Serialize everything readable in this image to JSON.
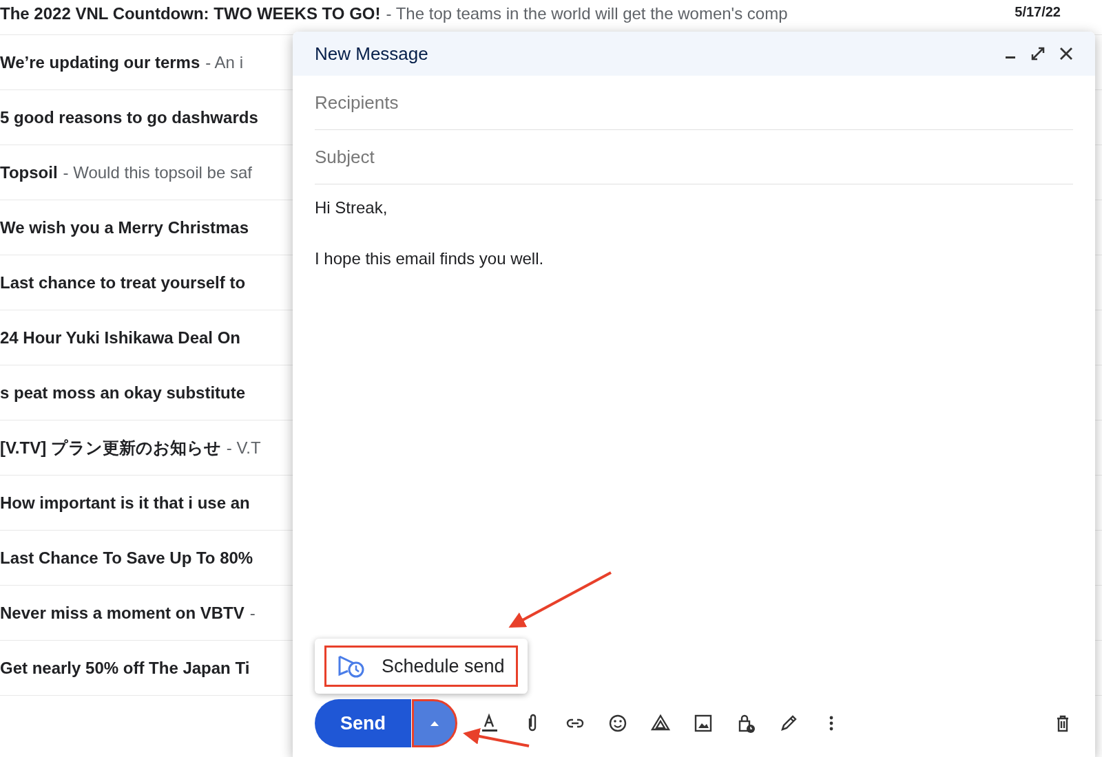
{
  "email_list": [
    {
      "subject": "The 2022 VNL Countdown: TWO WEEKS TO GO!",
      "snippet": "- The top teams in the world will get the women's comp",
      "date": "5/17/22"
    },
    {
      "subject": "We’re updating our terms",
      "snippet": "- An i"
    },
    {
      "subject": "5 good reasons to go dashwards"
    },
    {
      "subject": "Topsoil",
      "snippet": "- Would this topsoil be saf"
    },
    {
      "subject": "We wish you a Merry Christmas"
    },
    {
      "subject": "Last chance to treat yourself to"
    },
    {
      "subject": "24 Hour Yuki Ishikawa Deal On"
    },
    {
      "subject": "s peat moss an okay substitute"
    },
    {
      "subject": "[V.TV] プラン更新のお知らせ",
      "snippet": "- V.T"
    },
    {
      "subject": "How important is it that i use an"
    },
    {
      "subject": "Last Chance To Save Up To 80%"
    },
    {
      "subject": "Never miss a moment on VBTV",
      "snippet": "-"
    },
    {
      "subject": "Get nearly 50% off The Japan Ti"
    }
  ],
  "compose": {
    "title": "New Message",
    "recipients": {
      "placeholder": "Recipients"
    },
    "subject": {
      "placeholder": "Subject"
    },
    "body": [
      "Hi Streak,",
      "I hope this email finds you well."
    ],
    "menu": {
      "items": [
        "Schedule send"
      ]
    },
    "send_button": "Send"
  }
}
